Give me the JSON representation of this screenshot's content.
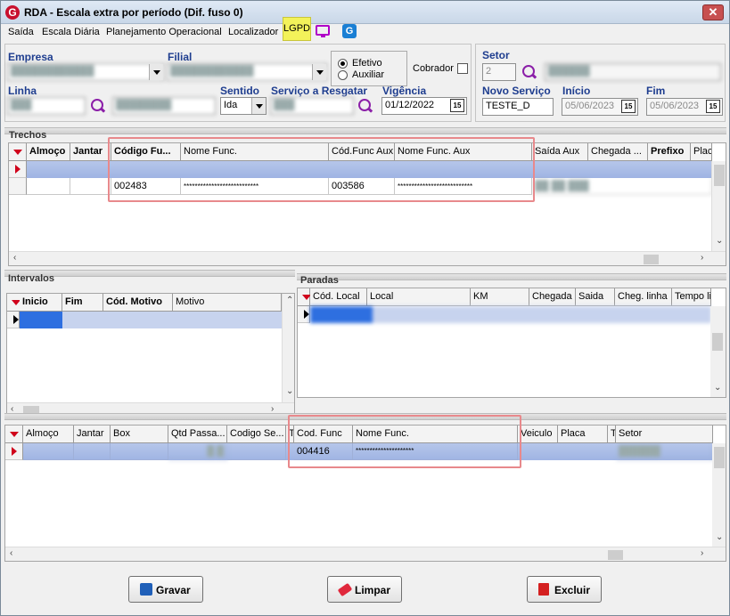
{
  "window": {
    "title": "RDA - Escala extra por período (Dif. fuso 0)",
    "app_icon": "G",
    "close": "✕"
  },
  "menu": [
    "Saída",
    "Escala Diária",
    "Planejamento Operacional",
    "Localizador"
  ],
  "lgpd_label": "LGPD",
  "form": {
    "empresa_label": "Empresa",
    "filial_label": "Filial",
    "linha_label": "Linha",
    "sentido_label": "Sentido",
    "sentido_value": "Ida",
    "servico_label": "Serviço a Resgatar",
    "vigencia_label": "Vigência",
    "vigencia_value": "01/12/2022",
    "efetivo_label": "Efetivo",
    "auxiliar_label": "Auxiliar",
    "cobrador_label": "Cobrador",
    "setor_label": "Setor",
    "setor_value": "2",
    "novo_servico_label": "Novo Serviço",
    "novo_servico_value": "TESTE_D",
    "inicio_label": "Início",
    "inicio_value": "05/06/2023",
    "fim_label": "Fim",
    "fim_value": "05/06/2023",
    "cal_glyph": "15"
  },
  "trechos": {
    "title": "Trechos",
    "headers": [
      "Almoço",
      "Jantar",
      "Código Fu...",
      "Nome Func.",
      "Cód.Func Aux",
      "Nome Func. Aux",
      "Saída Aux",
      "Chegada ...",
      "Prefixo",
      "Plac"
    ],
    "row2": {
      "codigo": "002483",
      "nome": "***************************",
      "cod_aux": "003586",
      "nome_aux": "***************************"
    }
  },
  "intervalos": {
    "title": "Intervalos",
    "headers": [
      "Inicio",
      "Fim",
      "Cód. Motivo",
      "Motivo"
    ]
  },
  "paradas": {
    "title": "Paradas",
    "headers": [
      "Cód. Local",
      "Local",
      "KM",
      "Chegada",
      "Saida",
      "Cheg. linha",
      "Tempo li"
    ]
  },
  "bottom_grid": {
    "headers": [
      "Almoço",
      "Jantar",
      "Box",
      "Qtd Passa...",
      "Codigo Se...",
      "T",
      "Cod. Func",
      "Nome Func.",
      "Veiculo",
      "Placa",
      "T",
      "Setor"
    ],
    "row1": {
      "cod_func": "004416",
      "nome": "*********************"
    }
  },
  "buttons": {
    "gravar": "Gravar",
    "limpar": "Limpar",
    "excluir": "Excluir"
  },
  "colors": {
    "label_blue": "#1e3d8f",
    "selected_row": "#a9bce6",
    "highlight_box": "#e8898c",
    "lgpd_bg": "#f3f25a"
  }
}
